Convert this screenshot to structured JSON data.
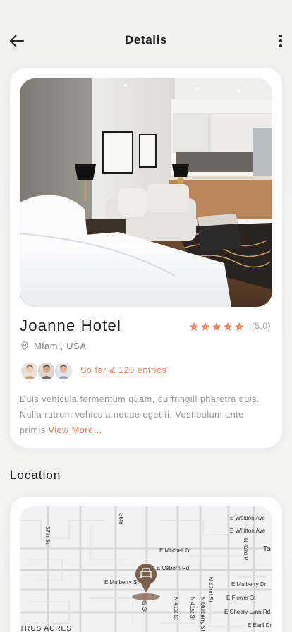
{
  "header": {
    "title": "Details",
    "back_icon": "arrow-left-icon",
    "menu_icon": "more-vertical-icon"
  },
  "hotel": {
    "name": "Joanne Hotel",
    "rating_text": "(5.0)",
    "rating": 5,
    "max_rating": 5,
    "location": "Miami, USA",
    "entries": "So far & 120 entries",
    "description": "Duis vehicula fermentum quam, eu fringill pharetra quis. Nulla rutrum vehicula neque eget fi. Vestibulum ante primis ",
    "view_more": "View More…"
  },
  "location_section": {
    "title": "Location"
  },
  "map": {
    "streets": {
      "weldon": "E Weldon Ave",
      "whitton": "E Whitton Ave",
      "mitchell": "E Mitchell Dr",
      "osborn": "E Osborn Rd",
      "mulberry_w": "E Mulberry St",
      "mulberry_e": "E Mulberry Dr",
      "flower": "E Flower St",
      "cheery": "E Cheery Lynn Rd",
      "earll": "E Earll Dr",
      "st37": "37th St",
      "st36": "36th",
      "st40": "40th St",
      "st41": "N 41st St",
      "st41b": "N 41st St",
      "st42": "N 42nd St",
      "st43": "N 43rd Pl",
      "mulberry_n": "N Mulberry St",
      "ta": "Ta",
      "district": "TRUS ACRES"
    }
  },
  "colors": {
    "accent": "#e8835d",
    "star": "#ef8466",
    "pin": "#7a6150"
  }
}
